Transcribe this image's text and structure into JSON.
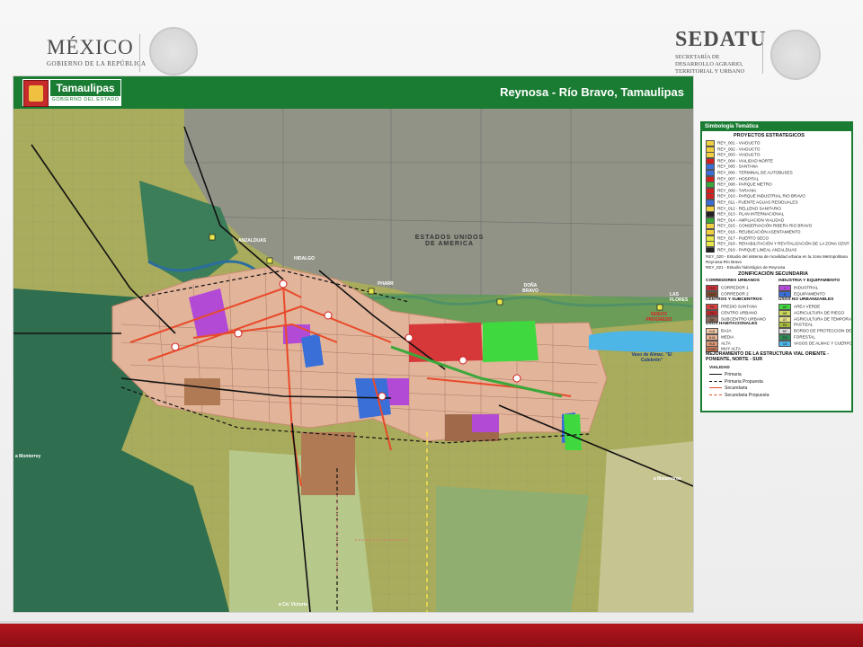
{
  "header": {
    "mexico": {
      "title": "MÉXICO",
      "subtitle": "GOBIERNO DE LA REPÚBLICA"
    },
    "sedatu": {
      "title": "SEDATU",
      "subtitle_line1": "SECRETARÍA DE",
      "subtitle_line2": "DESARROLLO AGRARIO,",
      "subtitle_line3": "TERRITORIAL Y URBANO"
    }
  },
  "map": {
    "state_logo": {
      "name": "Tamaulipas",
      "subtitle": "GOBIERNO DEL ESTADO"
    },
    "title": "Reynosa - Río Bravo, Tamaulipas",
    "labels": {
      "usa": "ESTADOS UNIDOS DE AMERICA",
      "anzalduas": "ANZALDUAS",
      "hidalgo": "HIDALGO",
      "pharr": "PHARR",
      "dona": "DOÑA BRAVO",
      "flores": "LAS FLORES",
      "nuevo_progreso": "NUEVO PROGRESO",
      "vaso": "Vaso de Almac. \"El Culebrón\"",
      "victoria": "a Cd. Victoria",
      "monterrey": "a Monterrey",
      "matamoros": "a Matamoros"
    }
  },
  "legend": {
    "title": "Simbología Temática",
    "proyectos_title": "PROYECTOS ESTRATEGICOS",
    "proyectos": [
      "REY_001 - VIADUCTO",
      "REY_002 - VIADUCTO",
      "REY_003 - VIADUCTO",
      "REY_004 - VIALIDAD NORTE",
      "REY_005 - SANTANA",
      "REY_006 - TERMINAL DE AUTOBUSES",
      "REY_007 - HOSPITAL",
      "REY_008 - PARQUE METRO",
      "REY_009 - TARAHIA",
      "REY_010 - PARQUE INDUSTRIAL RIO BRAVO",
      "REY_011 - PUENTE AGUAS RESIDUALES",
      "REY_012 - RELLENO SANITARIO",
      "REY_013 - PLAN INTERNACIONAL",
      "REY_014 - AMPLIACION VIALIDAD",
      "REY_015 - CONSERVACIÓN RIBERA RIO BRAVO",
      "REY_016 - REUBICACIÓN ASENTAMIENTO",
      "REY_017 - PUERTO SECO",
      "REY_018 - REHABILITACIÓN Y REVITALIZACIÓN DE LA ZONA CENTRO DE REYNOSA",
      "REY_019 - PARQUE LINEAL ANZALDUAS"
    ],
    "estudios": [
      "REY_020 - Estudio del sistema de movilidad urbana en la zona Metropolitana Reynosa-Río Bravo",
      "REY_021 - Estudio hidrológico de Reynosa"
    ],
    "zonificacion_title": "ZONIFICACIÓN SECUNDARIA",
    "corredores_title": "CORREDORES URBANOS",
    "corredores": [
      {
        "code": "CU1",
        "label": "CORREDOR 1",
        "color": "#c8303a"
      },
      {
        "code": "CU2",
        "label": "CORREDOR 2",
        "color": "#7e4a2f"
      }
    ],
    "centros_title": "CENTROS Y SUBCENTROS",
    "centros": [
      {
        "code": "PS",
        "label": "PREDIO SANTANA",
        "color": "#d94040"
      },
      {
        "code": "CU",
        "label": "CENTRO URBANO",
        "color": "#b72b2b"
      },
      {
        "code": "SU",
        "label": "SUBCENTRO URBANO",
        "color": "#8c6b5a"
      }
    ],
    "habitacionales_title": "USOS HABITACIONALES",
    "habitacionales": [
      {
        "code": "H-B",
        "label": "BAJA",
        "color": "#f2c6a5"
      },
      {
        "code": "H-M",
        "label": "MEDIA",
        "color": "#e8b291"
      },
      {
        "code": "H-A",
        "label": "ALTA",
        "color": "#d89574"
      },
      {
        "code": "H-MA",
        "label": "MUY ALTA",
        "color": "#c87a5a"
      }
    ],
    "industria_title": "INDUSTRIA Y EQUIPAMIENTO",
    "industria": [
      {
        "code": "I",
        "label": "INDUSTRIAL",
        "color": "#b24ad6"
      },
      {
        "code": "E",
        "label": "EQUIPAMIENTO",
        "color": "#3a6fd8"
      }
    ],
    "no_urbanizables_title": "USOS NO URBANIZABLES",
    "no_urbanizables": [
      {
        "code": "AV",
        "label": "AREA VERDE",
        "color": "#3fd93f"
      },
      {
        "code": "AR",
        "label": "AGRICULTURA DE RIEGO",
        "color": "#c8d65a"
      },
      {
        "code": "AT",
        "label": "AGRICULTURA DE TEMPORAL",
        "color": "#e6e28a"
      },
      {
        "code": "PA",
        "label": "PASTIZAL",
        "color": "#a6b83c"
      },
      {
        "code": "BP",
        "label": "BORDO DE PROTECCION DEL RIO BRAVO",
        "color": "#dddddd"
      },
      {
        "code": "FO",
        "label": "FORESTAL",
        "color": "#2e8b57"
      },
      {
        "code": "CA",
        "label": "VASOS DE ALMAC Y CUERPOS DE AGUA",
        "color": "#4db6e6"
      }
    ],
    "vial_title": "MEJORAMIENTO DE LA ESTRUCTURA VIAL ORIENTE - PONIENTE, NORTE - SUR",
    "vialidad_title": "VIALIDAD",
    "vialidad": [
      {
        "label": "Primaria",
        "color": "#111111",
        "style": "solid"
      },
      {
        "label": "Primaria Propuesta",
        "color": "#111111",
        "style": "dashed"
      },
      {
        "label": "Secundaria",
        "color": "#e84a2a",
        "style": "solid"
      },
      {
        "label": "Secundaria Propuesta",
        "color": "#e84a2a",
        "style": "dashed"
      }
    ]
  }
}
